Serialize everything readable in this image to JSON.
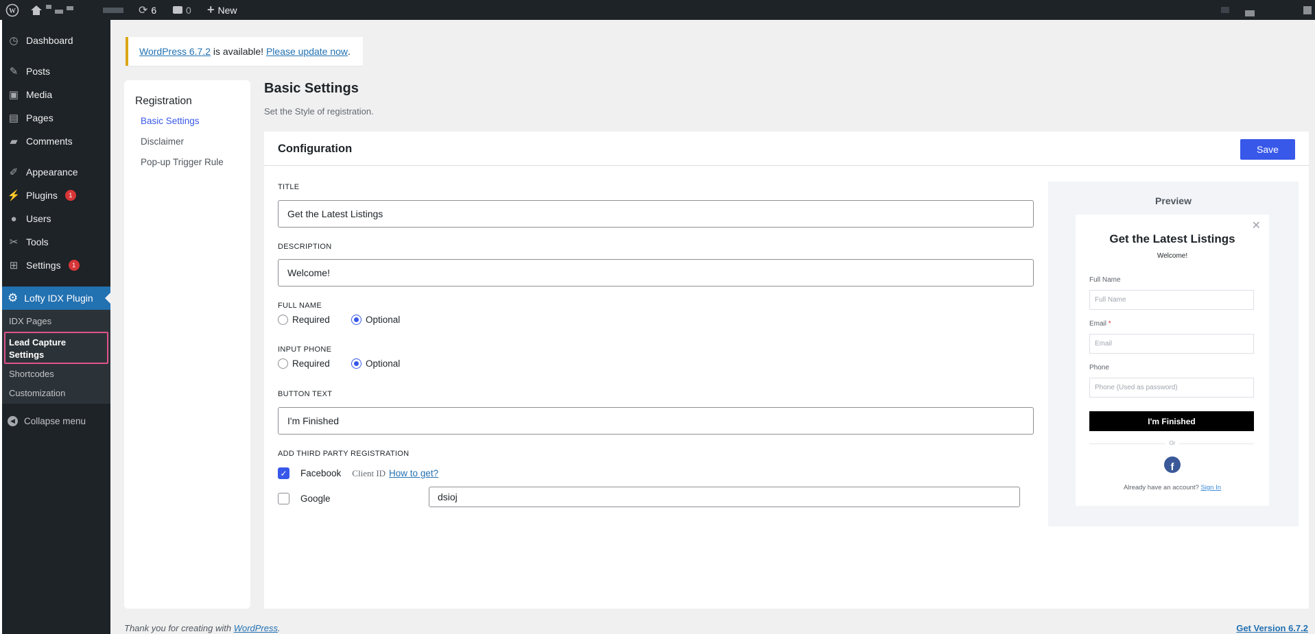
{
  "adminbar": {
    "updates": "6",
    "comments": "0",
    "new_label": "New"
  },
  "sidebar": {
    "items": [
      {
        "id": "dashboard",
        "label": "Dashboard",
        "icon": "dashboard-icon",
        "glyph": "◷"
      },
      {
        "id": "posts",
        "label": "Posts",
        "icon": "pin-icon",
        "glyph": "✎"
      },
      {
        "id": "media",
        "label": "Media",
        "icon": "media-icon",
        "glyph": "▣"
      },
      {
        "id": "pages",
        "label": "Pages",
        "icon": "pages-icon",
        "glyph": "▤"
      },
      {
        "id": "comments",
        "label": "Comments",
        "icon": "comment-icon",
        "glyph": "▰"
      },
      {
        "id": "appearance",
        "label": "Appearance",
        "icon": "brush-icon",
        "glyph": "✐"
      },
      {
        "id": "plugins",
        "label": "Plugins",
        "icon": "plugin-icon",
        "glyph": "⚡",
        "badge": "1"
      },
      {
        "id": "users",
        "label": "Users",
        "icon": "user-icon",
        "glyph": "●"
      },
      {
        "id": "tools",
        "label": "Tools",
        "icon": "wrench-icon",
        "glyph": "✂"
      },
      {
        "id": "settings",
        "label": "Settings",
        "icon": "settings-icon",
        "glyph": "⊞",
        "badge": "1"
      }
    ],
    "current": {
      "label": "Lofty IDX Plugin",
      "icon": "gear-icon"
    },
    "submenu": [
      "IDX Pages",
      "Lead Capture Settings",
      "Shortcodes",
      "Customization"
    ],
    "collapse": "Collapse menu"
  },
  "notice": {
    "version_link": "WordPress 6.7.2",
    "middle": " is available! ",
    "update_link": "Please update now",
    "end": "."
  },
  "subnav": {
    "heading": "Registration",
    "items": [
      "Basic Settings",
      "Disclaimer",
      "Pop-up Trigger Rule"
    ]
  },
  "page": {
    "title": "Basic Settings",
    "subtitle": "Set the Style of registration."
  },
  "config": {
    "heading": "Configuration",
    "save": "Save",
    "title_label": "TITLE",
    "title_value": "Get the Latest Listings",
    "desc_label": "DESCRIPTION",
    "desc_value": "Welcome!",
    "fullname_label": "FULL NAME",
    "phone_label": "INPUT PHONE",
    "required": "Required",
    "optional": "Optional",
    "fullname_choice": "Optional",
    "phone_choice": "Optional",
    "button_label": "BUTTON TEXT",
    "button_value": "I'm Finished",
    "third_label": "ADD THIRD PARTY REGISTRATION",
    "facebook": "Facebook",
    "facebook_checked": true,
    "client_id": "Client ID",
    "how_to": "How to get?",
    "client_value": "dsioj",
    "google": "Google",
    "google_checked": false
  },
  "preview": {
    "heading": "Preview",
    "title": "Get the Latest Listings",
    "desc": "Welcome!",
    "fullname_label": "Full Name",
    "fullname_ph": "Full Name",
    "email_label": "Email",
    "email_ph": "Email",
    "required_mark": "*",
    "phone_label": "Phone",
    "phone_ph": "Phone (Used as password)",
    "button": "I'm Finished",
    "or": "Or",
    "account": "Already have an account?",
    "signin": "Sign In"
  },
  "footer": {
    "text": "Thank you for creating with ",
    "link": "WordPress",
    "end": ".",
    "version": "Get Version 6.7.2"
  }
}
